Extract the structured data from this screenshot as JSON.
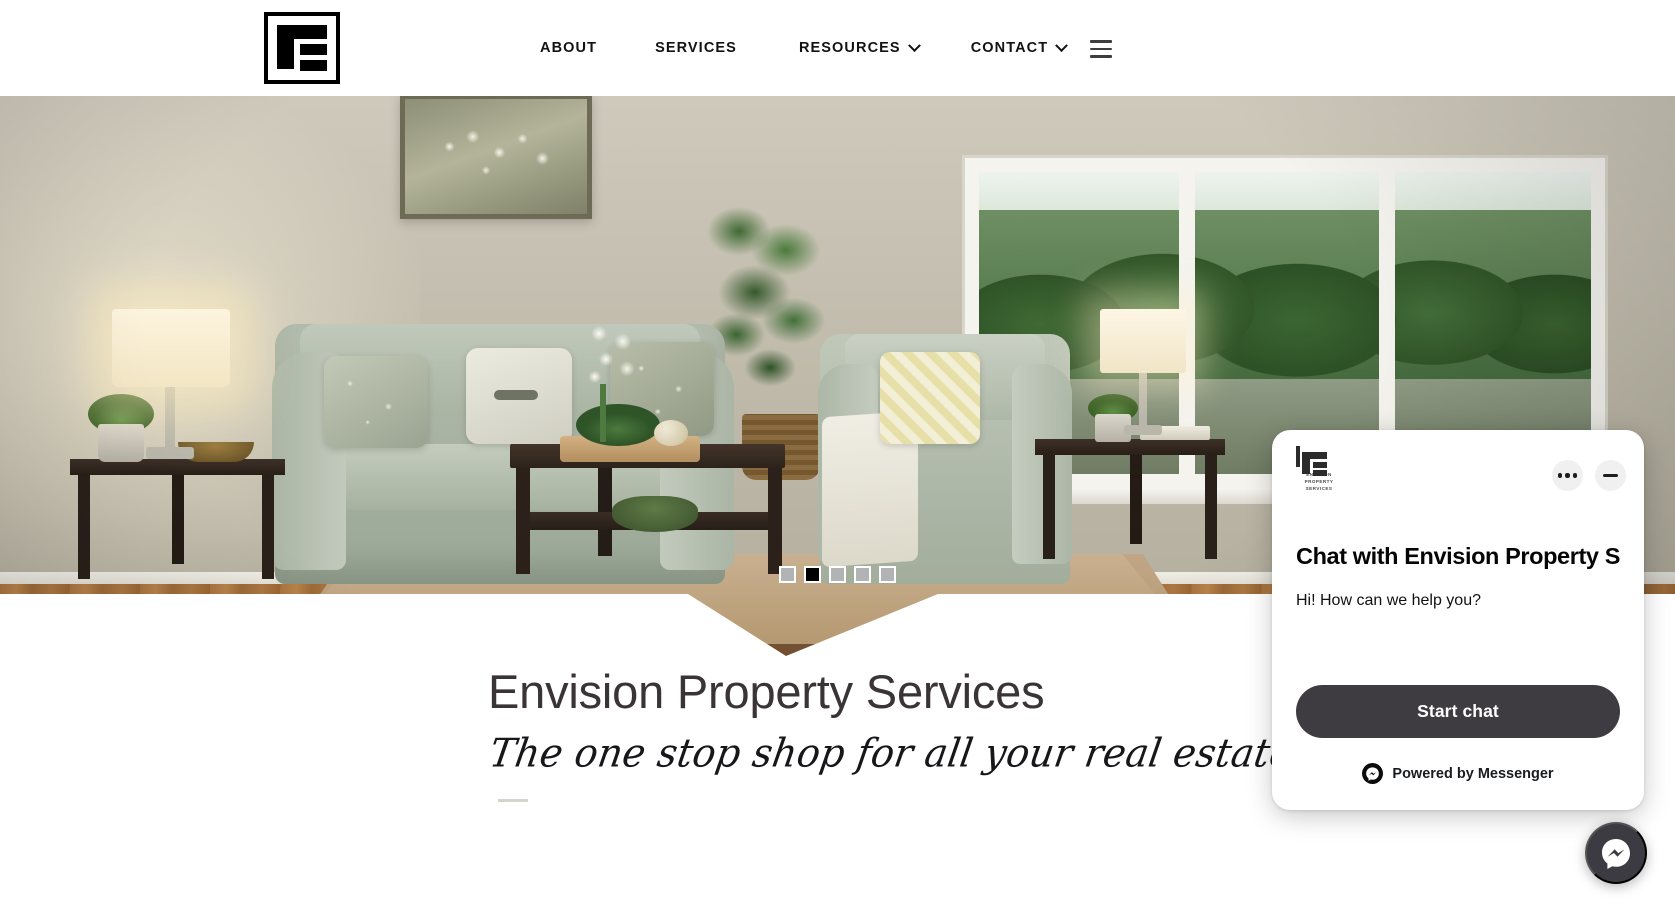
{
  "site": {
    "brand_name": "Envision Property Services",
    "logo_icon": "envision-e-logo"
  },
  "header": {
    "nav_items": [
      {
        "label": "ABOUT",
        "has_dropdown": false
      },
      {
        "label": "SERVICES",
        "has_dropdown": false
      },
      {
        "label": "RESOURCES",
        "has_dropdown": true
      },
      {
        "label": "CONTACT",
        "has_dropdown": true
      }
    ],
    "menu_icon": "hamburger-menu-icon"
  },
  "hero": {
    "image_alt": "Staged living room with sage green sofa, armchair, coffee table and window",
    "slider": {
      "total": 5,
      "active_index": 1
    }
  },
  "main": {
    "title": "Envision Property Services",
    "tagline": "The one stop shop for all your real estate needs."
  },
  "chat": {
    "brand_mark_icon": "envision-e-logo",
    "brand_mark_text": "ENVISION PROPERTY\nSERVICES",
    "more_icon": "more-options-icon",
    "minimize_icon": "minimize-icon",
    "title": "Chat with Envision Property Servi…",
    "greeting": "Hi! How can we help you?",
    "start_button": "Start chat",
    "powered_by": "Powered by Messenger",
    "powered_icon": "messenger-icon",
    "fab_icon": "messenger-icon"
  },
  "colors": {
    "button_dark": "#3f3c41",
    "text_dark": "#050505",
    "title_gray": "#3b3436",
    "dot_inactive": "#b2b3b5",
    "dot_active": "#000000",
    "fab_bg": "#3c3b41"
  }
}
